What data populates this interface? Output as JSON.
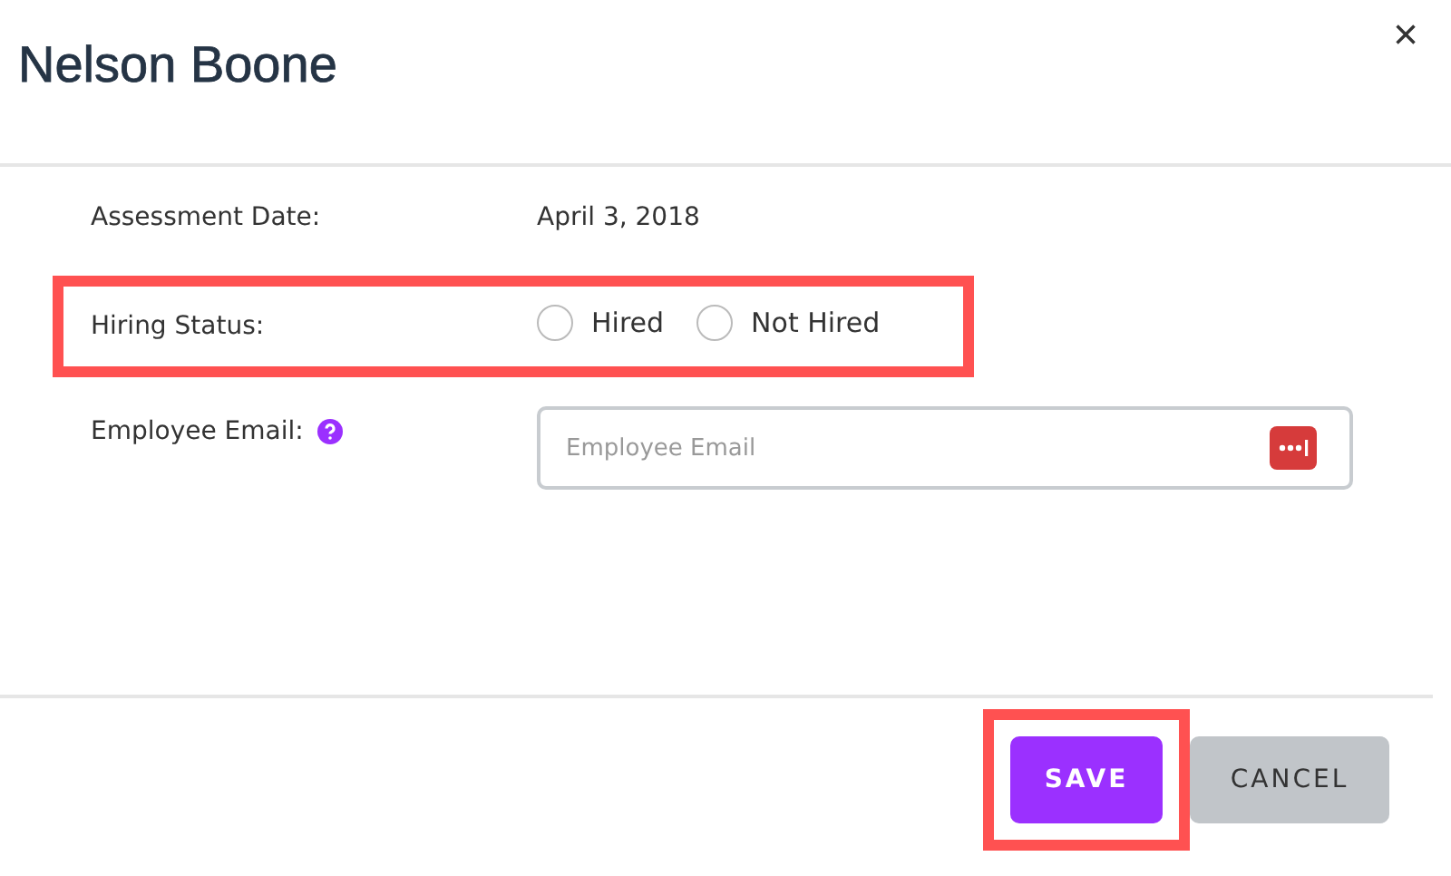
{
  "dialog": {
    "title": "Nelson Boone",
    "close": "×"
  },
  "fields": [
    {
      "kind": "text",
      "label": "Assessment Date:",
      "value": "April 3, 2018",
      "highlighted": false
    },
    {
      "kind": "radio",
      "label": "Hiring Status:",
      "highlighted": true,
      "options": [
        {
          "label": "Hired",
          "selected": false
        },
        {
          "label": "Not Hired",
          "selected": false
        }
      ]
    },
    {
      "kind": "input",
      "label": "Employee Email:",
      "help": true,
      "placeholder": "Employee Email",
      "highlighted": false
    }
  ],
  "buttons": [
    {
      "label": "SAVE",
      "kind": "primary",
      "highlighted": true
    },
    {
      "label": "CANCEL",
      "kind": "secondary",
      "highlighted": false
    }
  ]
}
